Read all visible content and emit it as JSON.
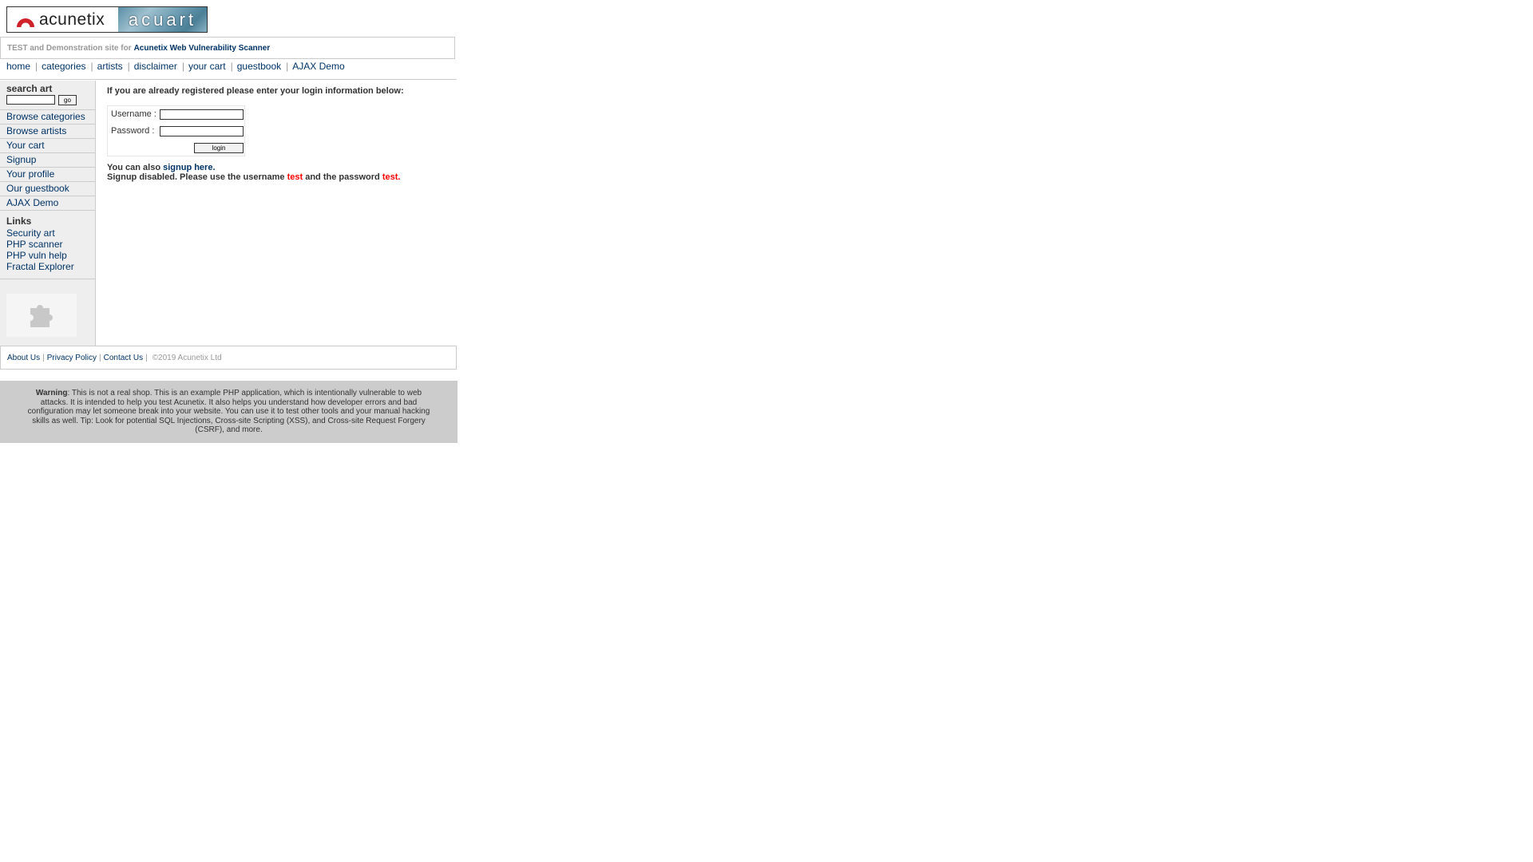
{
  "header": {
    "logo_left_text": "acunetix",
    "logo_right_text": "acuart",
    "tagline_prefix": "TEST and Demonstration site for",
    "tagline_link": "Acunetix Web Vulnerability Scanner"
  },
  "topnav": [
    {
      "label": "home"
    },
    {
      "label": "categories"
    },
    {
      "label": "artists"
    },
    {
      "label": "disclaimer"
    },
    {
      "label": "your cart"
    },
    {
      "label": "guestbook"
    },
    {
      "label": "AJAX Demo"
    }
  ],
  "sidebar": {
    "search_title": "search art",
    "search_value": "",
    "go_label": "go",
    "menu": [
      {
        "label": "Browse categories"
      },
      {
        "label": "Browse artists"
      },
      {
        "label": "Your cart"
      },
      {
        "label": "Signup"
      },
      {
        "label": "Your profile"
      },
      {
        "label": "Our guestbook"
      },
      {
        "label": "AJAX Demo"
      }
    ],
    "links_title": "Links",
    "links": [
      {
        "label": "Security art"
      },
      {
        "label": "PHP scanner"
      },
      {
        "label": "PHP vuln help"
      },
      {
        "label": "Fractal Explorer"
      }
    ]
  },
  "main": {
    "intro": "If you are already registered please enter your login information below:",
    "username_label": "Username :",
    "username_value": "",
    "password_label": "Password :",
    "password_value": "",
    "login_label": "login",
    "signup_prefix": "You can also",
    "signup_link": "signup here.",
    "disabled_prefix": "Signup disabled. Please use the username",
    "disabled_user": "test",
    "disabled_middle": "and the password",
    "disabled_pass": "test."
  },
  "footer": {
    "links": [
      {
        "label": "About Us"
      },
      {
        "label": "Privacy Policy"
      },
      {
        "label": "Contact Us"
      }
    ],
    "copyright": "©2019 Acunetix Ltd"
  },
  "warning": {
    "bold": "Warning",
    "text": ": This is not a real shop. This is an example PHP application, which is intentionally vulnerable to web attacks. It is intended to help you test Acunetix. It also helps you understand how developer errors and bad configuration may let someone break into your website. You can use it to test other tools and your manual hacking skills as well. Tip: Look for potential SQL Injections, Cross-site Scripting (XSS), and Cross-site Request Forgery (CSRF), and more."
  },
  "colors": {
    "link": "#003366",
    "accent_red": "#ff0000",
    "sidebar_bg": "#eeeeee",
    "warning_bg": "#cccccc"
  }
}
